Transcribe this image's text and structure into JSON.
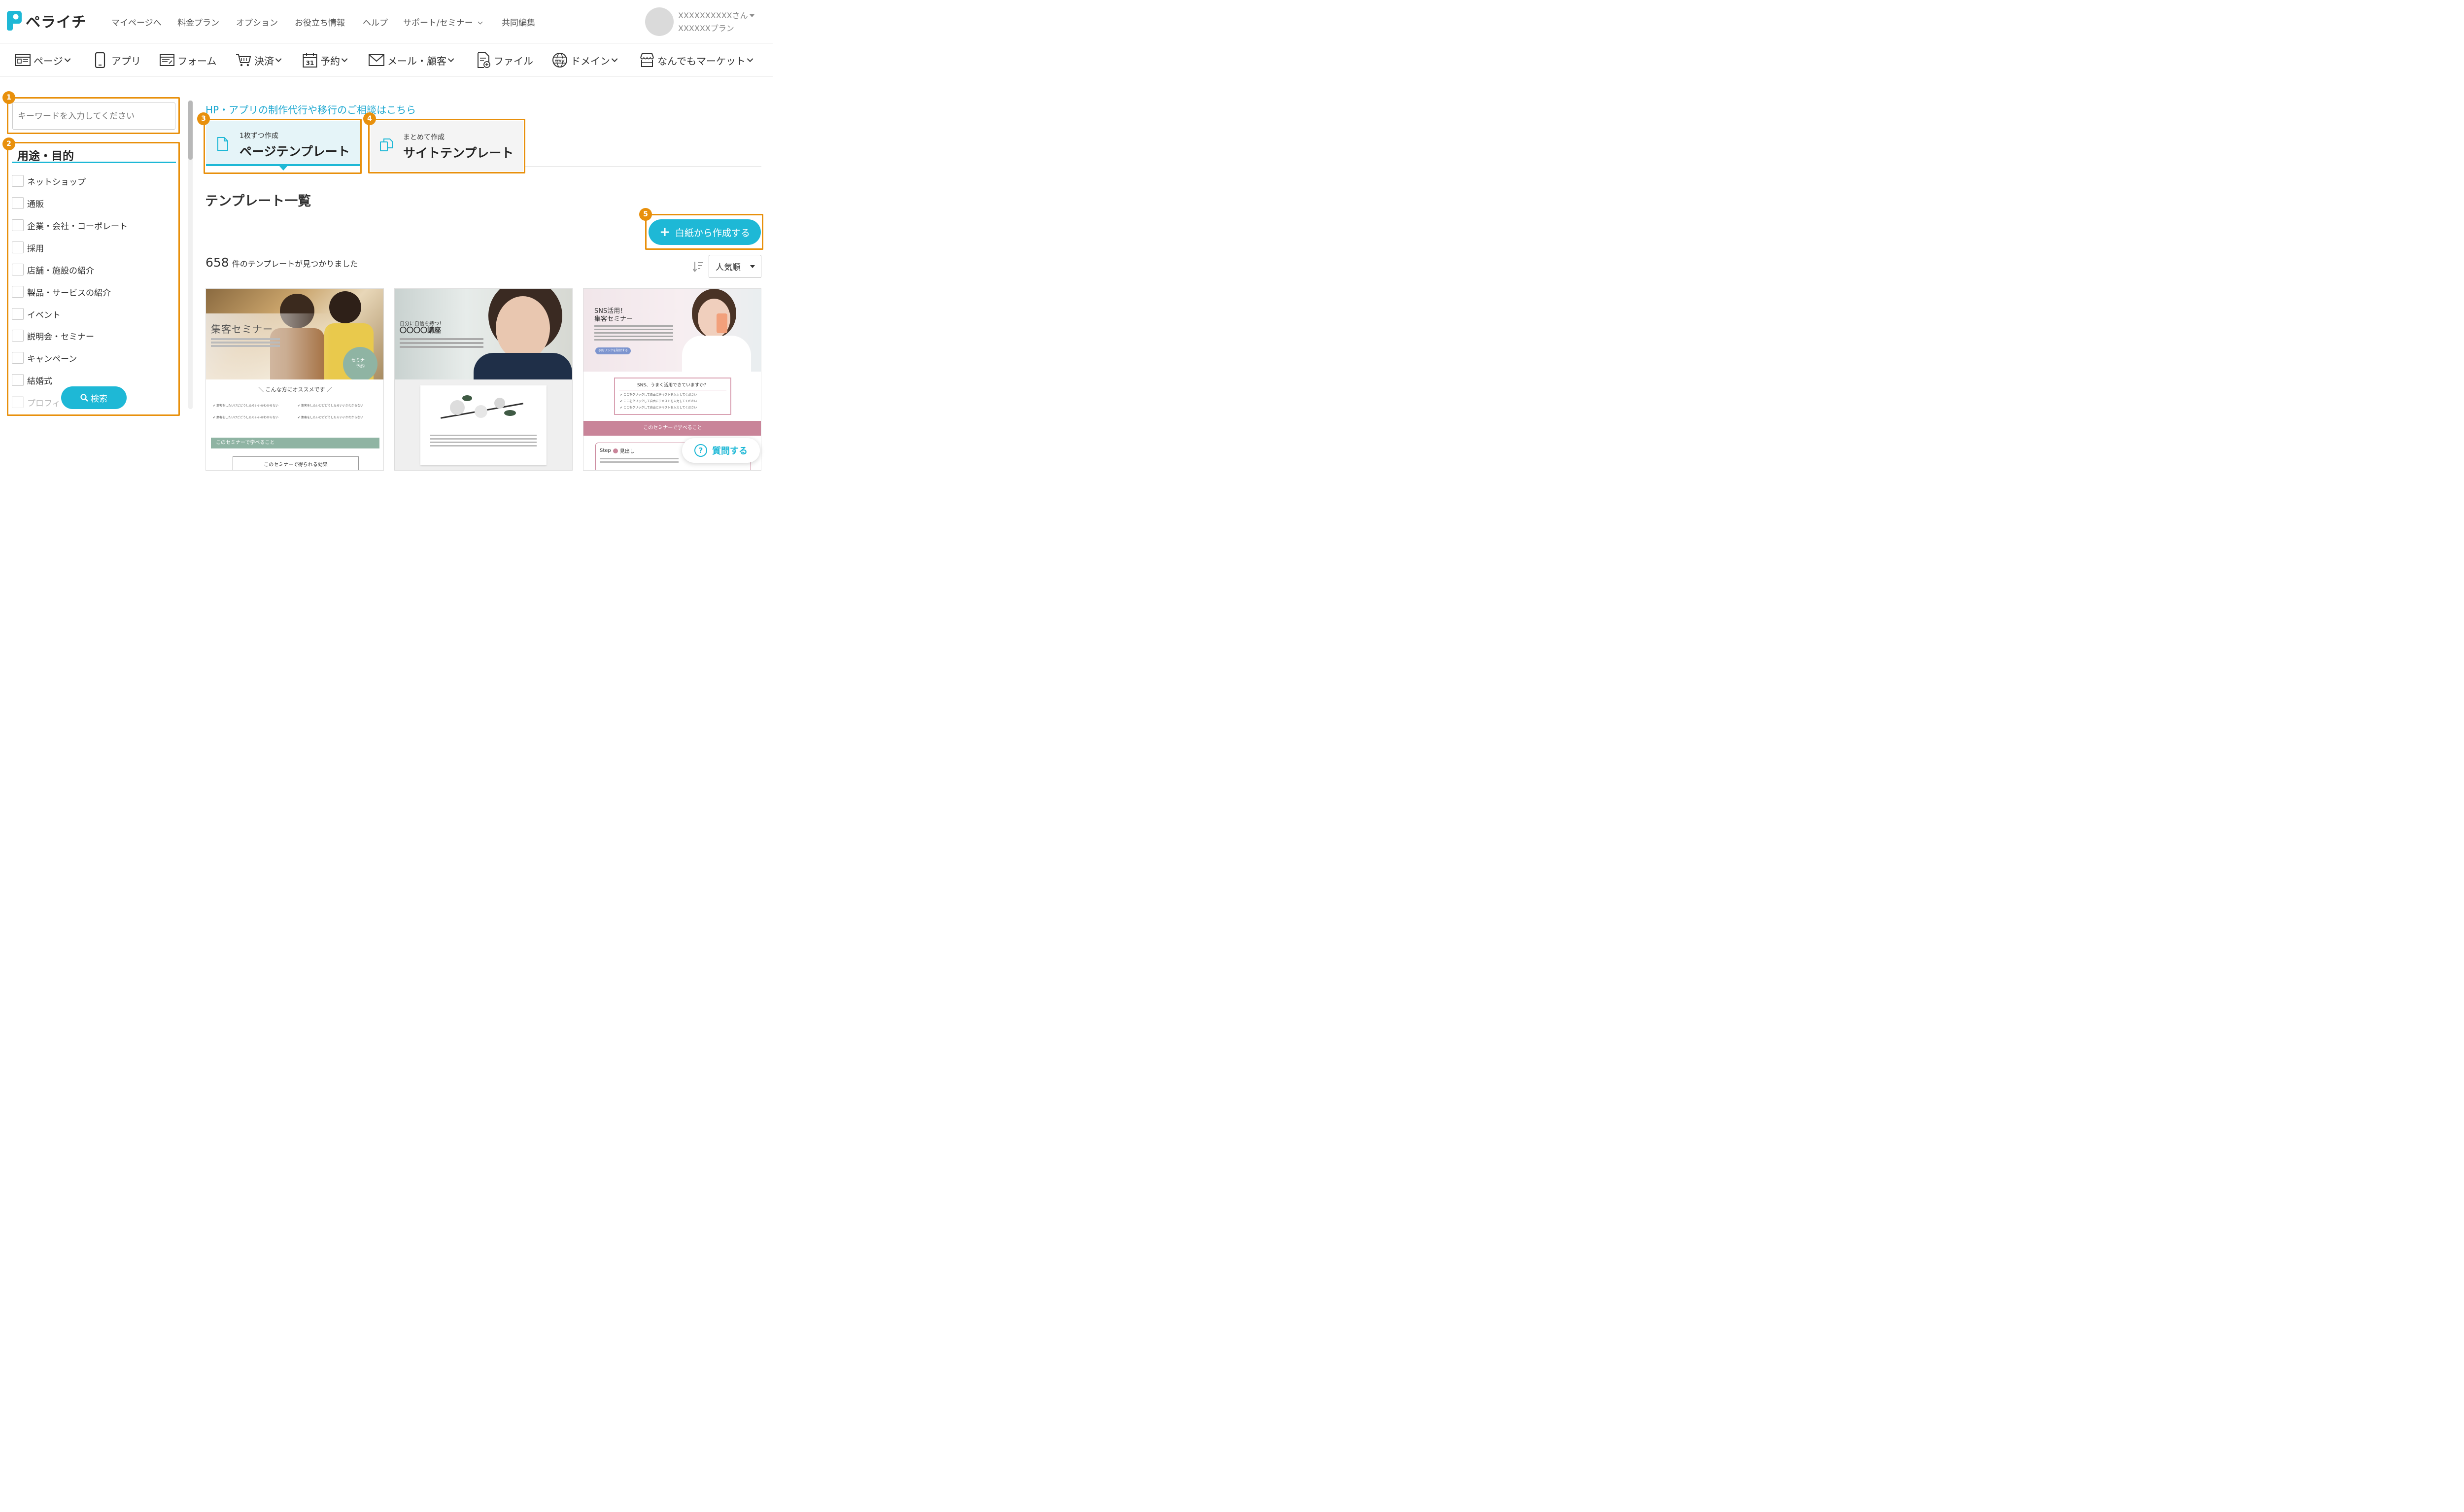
{
  "header": {
    "logo": "ペライチ",
    "nav": [
      "マイページへ",
      "料金プラン",
      "オプション",
      "お役立ち情報",
      "ヘルプ",
      "サポート/セミナー",
      "共同編集"
    ],
    "user_name": "XXXXXXXXXXさん",
    "user_plan": "XXXXXXプラン"
  },
  "toolbar": {
    "items": [
      "ページ",
      "アプリ",
      "フォーム",
      "決済",
      "予約",
      "メール・顧客",
      "ファイル",
      "ドメイン",
      "なんでもマーケット"
    ],
    "calendar_day": "31",
    "www": "www"
  },
  "annotations": [
    "1",
    "2",
    "3",
    "4",
    "5"
  ],
  "sidebar": {
    "search_placeholder": "キーワードを入力してください",
    "section_title": "用途・目的",
    "categories": [
      "ネットショップ",
      "通販",
      "企業・会社・コーポレート",
      "採用",
      "店舗・施設の紹介",
      "製品・サービスの紹介",
      "イベント",
      "説明会・セミナー",
      "キャンペーン",
      "結婚式",
      "プロフィ"
    ],
    "search_button": "検索"
  },
  "main": {
    "consult_link": "HP・アプリの制作代行や移行のご相談はこちら",
    "tabs": [
      {
        "sub": "1枚ずつ作成",
        "label": "ページテンプレート"
      },
      {
        "sub": "まとめて作成",
        "label": "サイトテンプレート"
      }
    ],
    "list_title": "テンプレート一覧",
    "create_blank_button": "白紙から作成する",
    "result_count": "658",
    "result_suffix": "件のテンプレートが見つかりました",
    "sort_value": "人気順",
    "help_button": "質問する"
  },
  "templates": [
    {
      "title": "集客セミナー",
      "badge": "セミナー予約",
      "recommend": "＼ こんな方にオススメです ／",
      "check_text": "集客をしたいけどどうしたらいいかわからない",
      "learn": "このセミナーで学べること",
      "effect": "このセミナーで得られる効果"
    },
    {
      "title_line1": "自分に自信を持つ！",
      "title_line2": "〇〇〇〇講座"
    },
    {
      "title_line1": "SNS活用！",
      "title_line2": "集客セミナー",
      "button": "予約リンクを貼付する",
      "question": "SNS、うまく活用できていますか？",
      "check_text": "ここをクリックして自由にテキストを入力してください",
      "learn": "このセミナーで学べること",
      "step_label": "Step",
      "step_title": "見出し"
    }
  ],
  "colors": {
    "accent": "#1eb8d6",
    "annotation": "#e8900c",
    "tab_active_bg": "#e5f4f8",
    "link": "#1ba7d0"
  }
}
